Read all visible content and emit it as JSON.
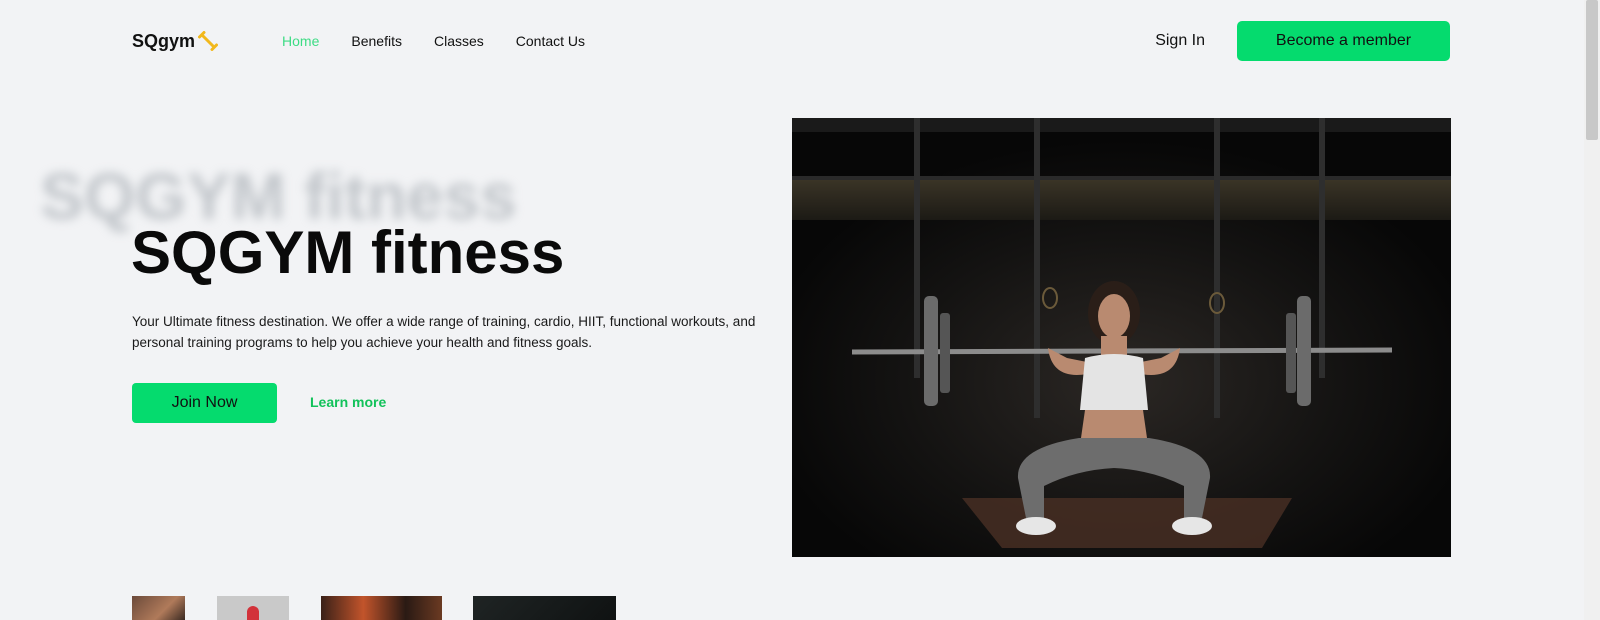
{
  "header": {
    "logo_text": "SQgym",
    "logo_icon": "dumbbell-icon",
    "nav": [
      {
        "label": "Home",
        "active": true
      },
      {
        "label": "Benefits",
        "active": false
      },
      {
        "label": "Classes",
        "active": false
      },
      {
        "label": "Contact Us",
        "active": false
      }
    ],
    "sign_in_label": "Sign In",
    "member_button_label": "Become a member"
  },
  "hero": {
    "ghost_title": "SQGYM fitness",
    "title": "SQGYM fitness",
    "description": "Your Ultimate fitness destination. We offer a wide range of training, cardio, HIIT, functional workouts, and personal training programs to help you achieve your health and fitness goals.",
    "join_button_label": "Join Now",
    "learn_more_label": "Learn more"
  },
  "colors": {
    "accent": "#05db6e",
    "nav_active": "#3ddc84",
    "link": "#12c25a",
    "logo_icon": "#f2b81c",
    "background": "#f2f3f5"
  }
}
